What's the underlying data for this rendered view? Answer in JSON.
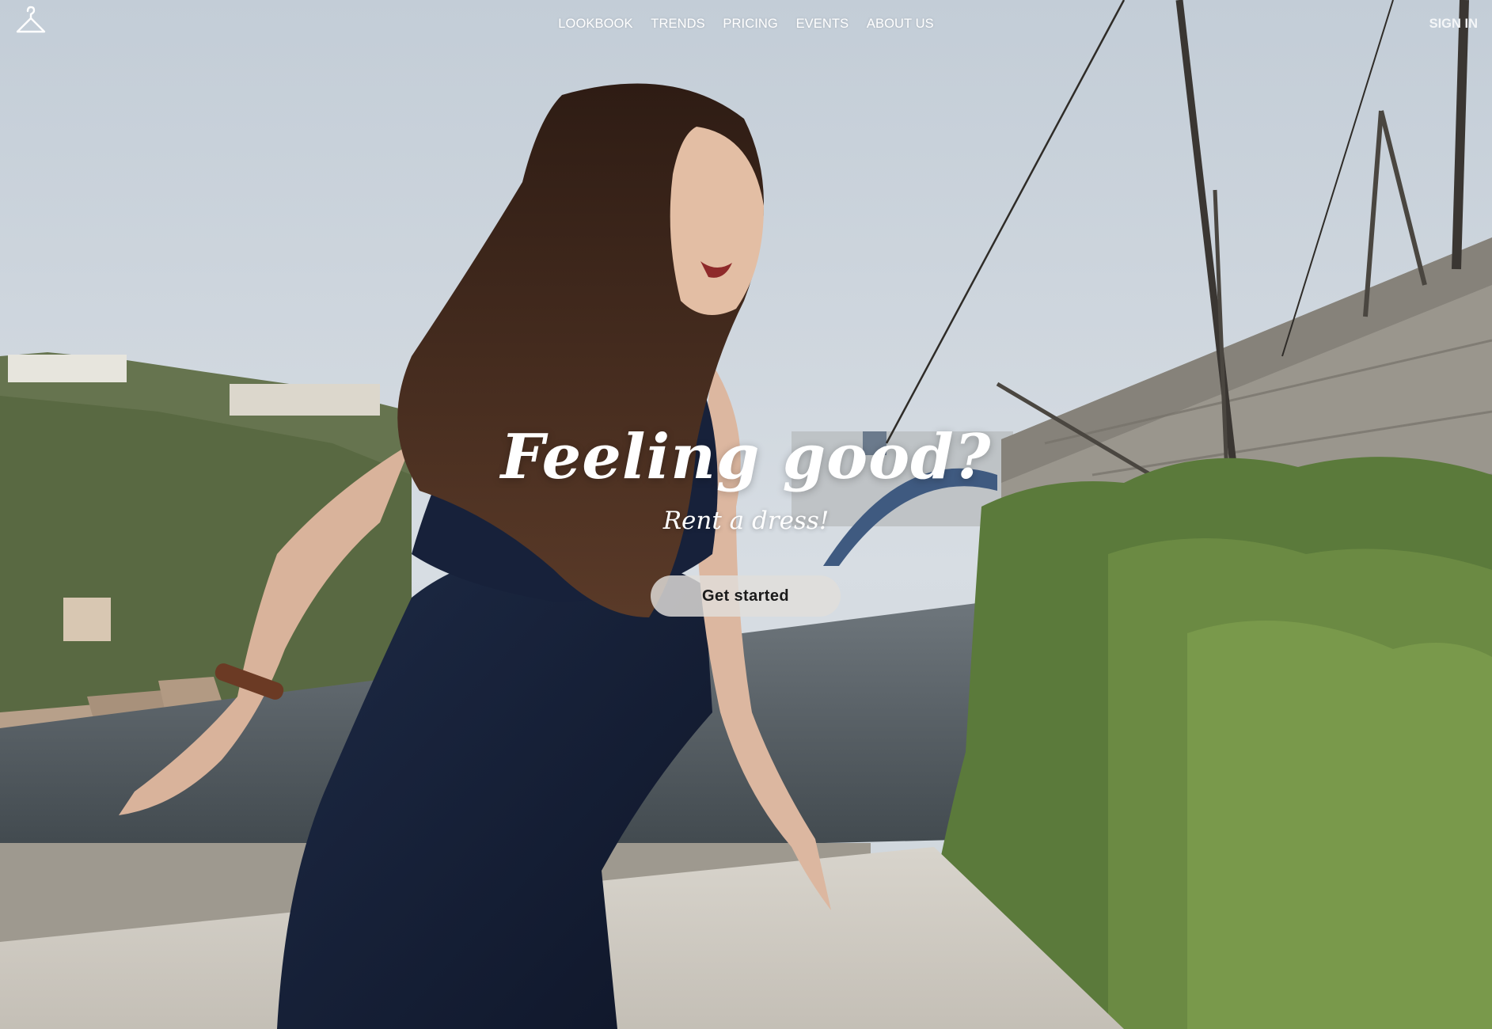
{
  "nav": {
    "logo_icon": "hanger-icon",
    "items": [
      {
        "label": "LOOKBOOK"
      },
      {
        "label": "TRENDS"
      },
      {
        "label": "PRICING"
      },
      {
        "label": "EVENTS"
      },
      {
        "label": "ABOUT US"
      }
    ],
    "sign_in_label": "SIGN IN"
  },
  "hero": {
    "headline": "Feeling good?",
    "subheadline": "Rent a dress!",
    "cta_label": "Get started",
    "background_description_icon": "woman-dancing-photo"
  },
  "colors": {
    "sky": "#c9d3dc",
    "dress": "#17213a",
    "hair": "#3a2418",
    "foliage": "#5b7a3b",
    "wall": "#8c8880",
    "water": "#4b5358",
    "cta_bg": "#e1deda",
    "text": "#ffffff"
  }
}
